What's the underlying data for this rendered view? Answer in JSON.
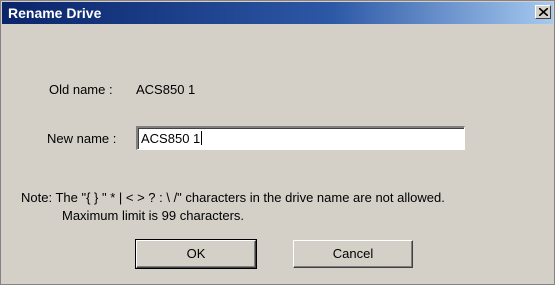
{
  "dialog": {
    "title": "Rename Drive",
    "old_name_label": "Old name :",
    "old_name_value": "ACS850 1",
    "new_name_label": "New name :",
    "new_name_value": "ACS850 1",
    "note_line1": "Note: The \"{ } \" * | < > ? : \\ /\" characters in the drive name are not allowed.",
    "note_line2": "Maximum limit is 99 characters.",
    "ok_label": "OK",
    "cancel_label": "Cancel"
  },
  "icons": {
    "close": "close-icon"
  },
  "colors": {
    "titlebar_start": "#0a246a",
    "titlebar_end": "#a6caf0",
    "dialog_bg": "#d4d0c8"
  }
}
